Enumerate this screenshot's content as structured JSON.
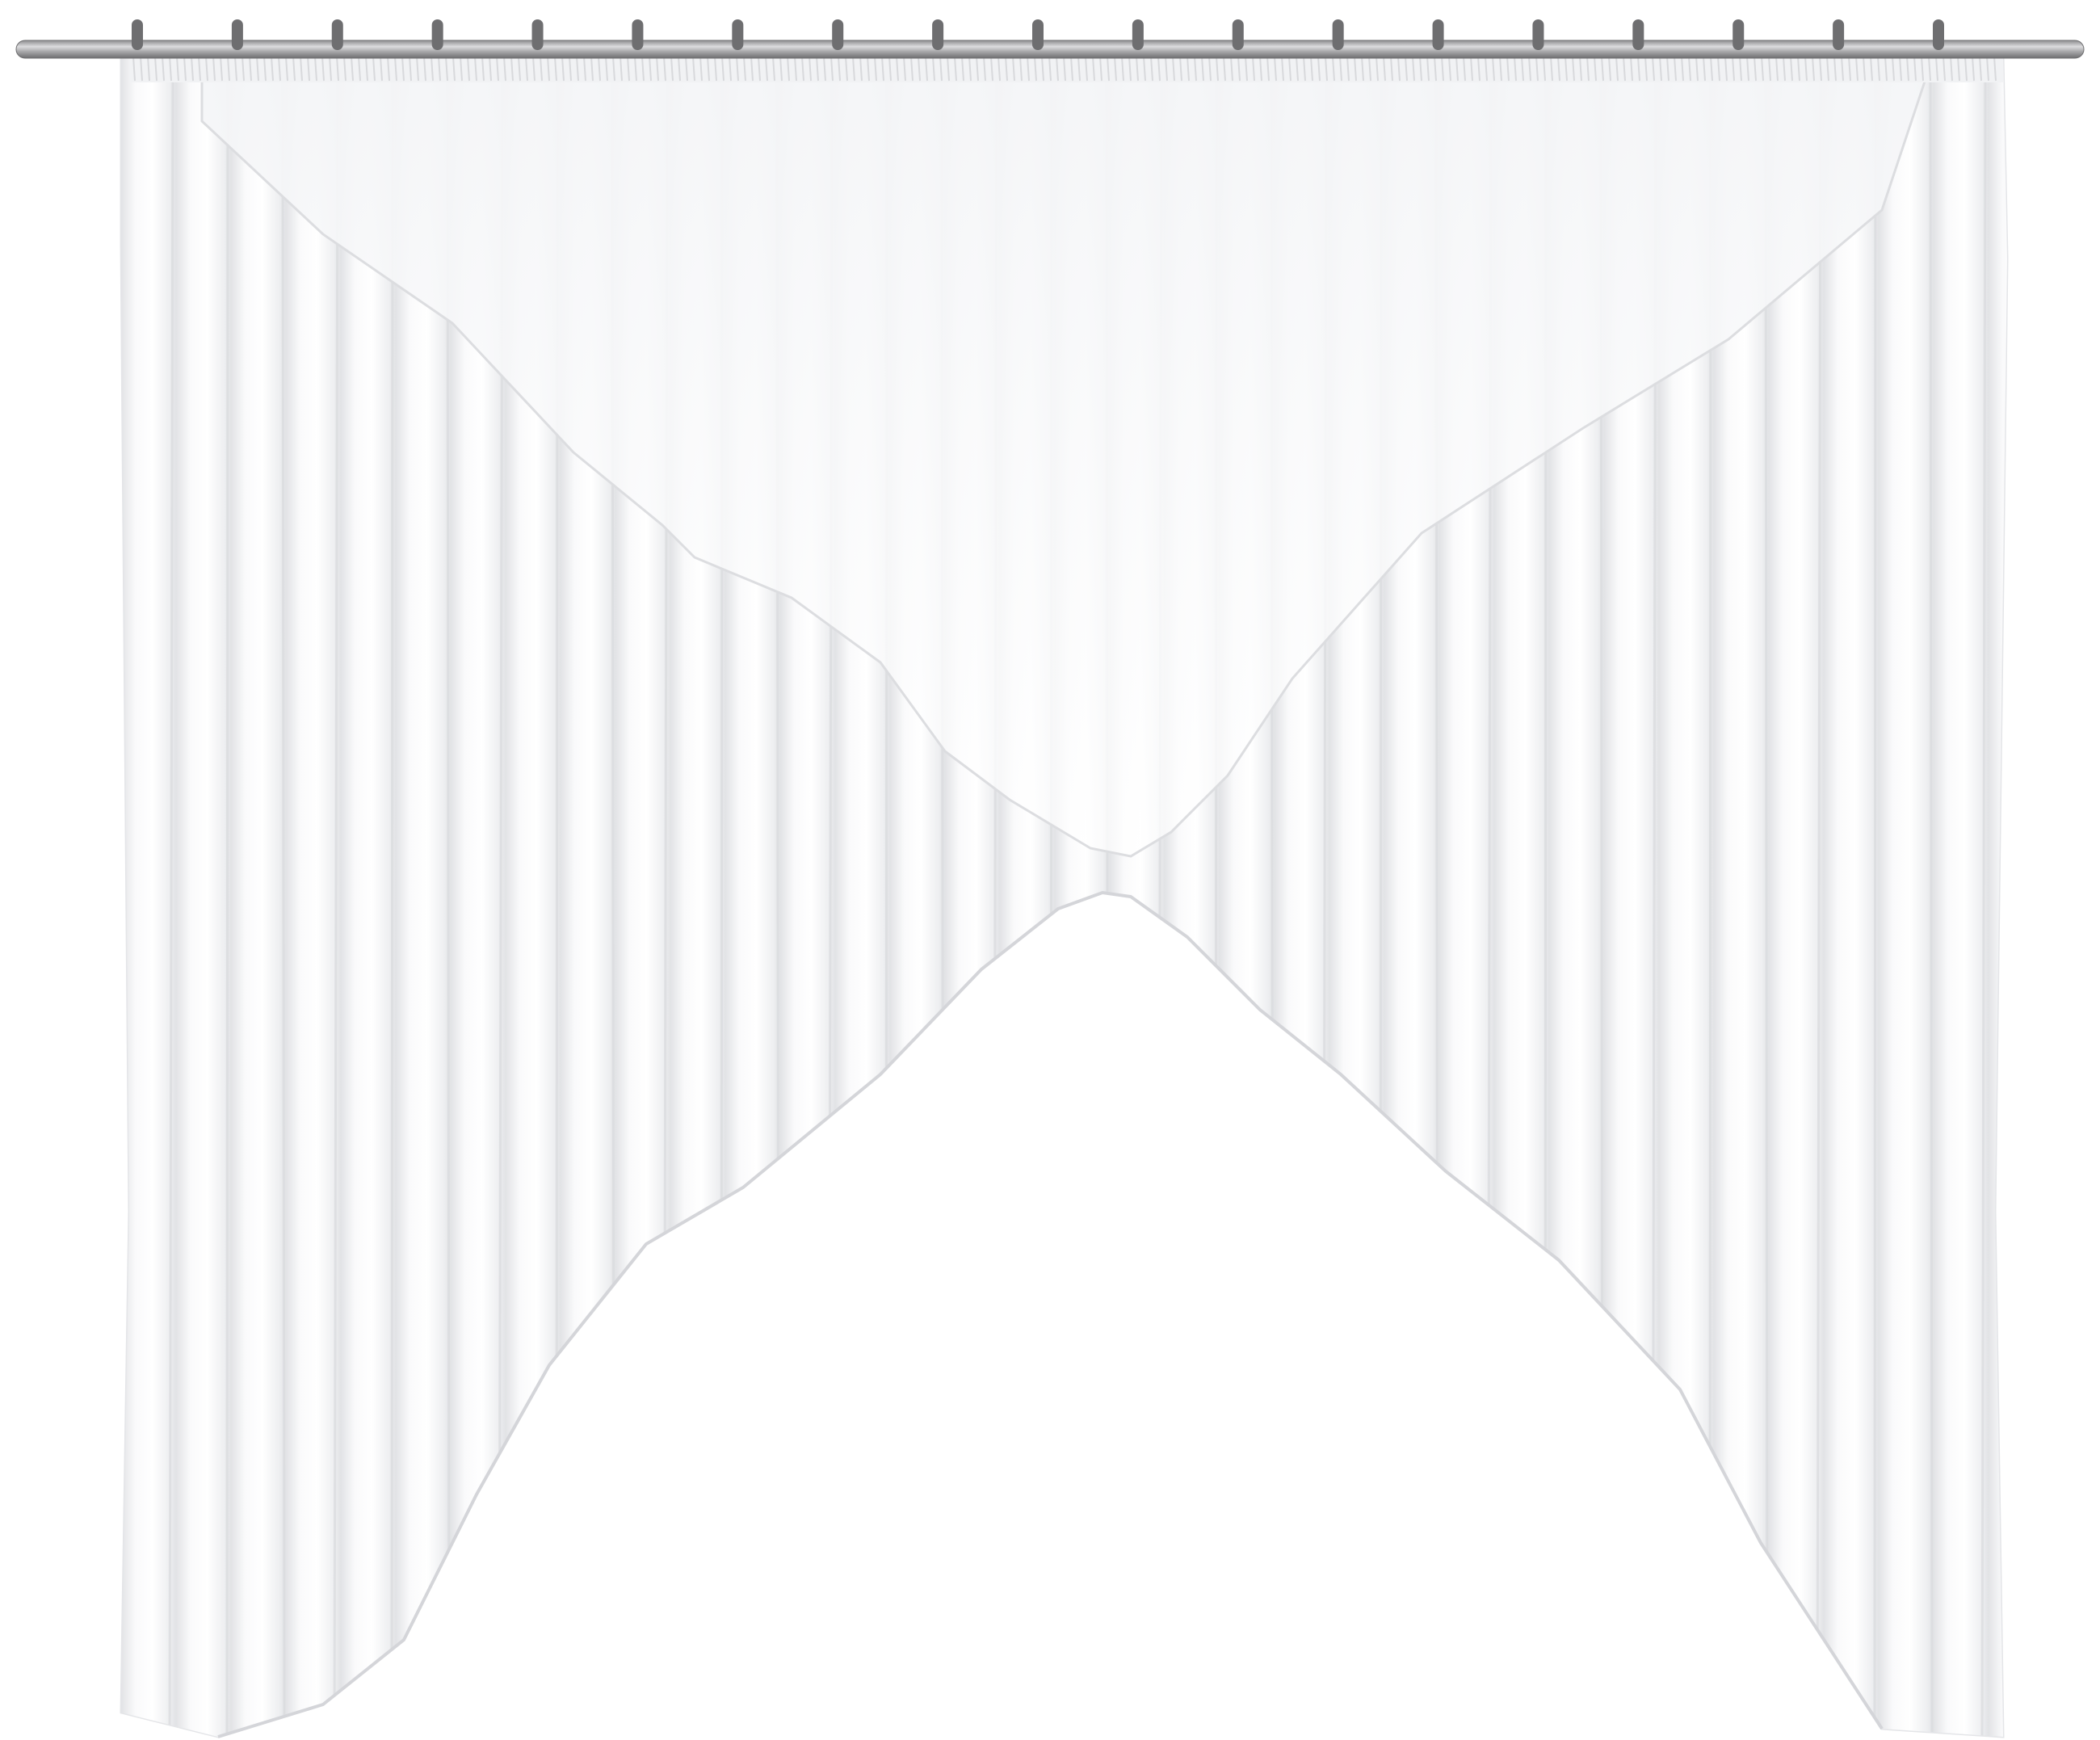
{
  "scene": {
    "subject": "curtain",
    "background_color": "#ffffff",
    "fabric_color": "#f7f7f8",
    "fabric_shadow_color": "#d9dadd",
    "fabric_highlight_color": "#ffffff",
    "rod_color": "#9a9a9c",
    "rod_highlight_color": "#d6d6d8",
    "ring_color": "#6e6e70",
    "ring_count": 19
  }
}
